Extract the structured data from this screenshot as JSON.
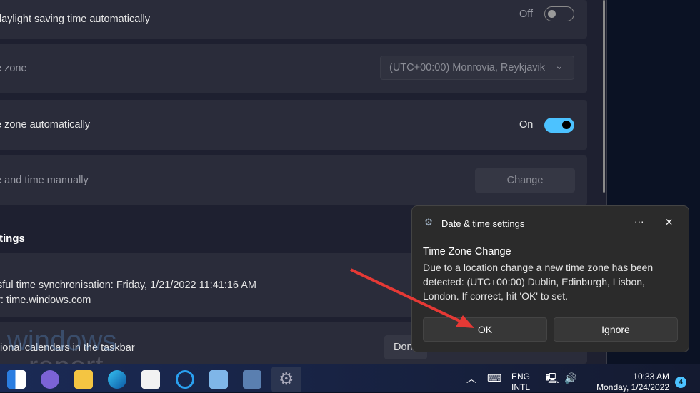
{
  "settings": {
    "dst_label": "daylight saving time automatically",
    "dst_state": "Off",
    "tz_label": "e zone",
    "tz_value": "(UTC+00:00) Monrovia, Reykjavik",
    "tz_auto_label": "e zone automatically",
    "tz_auto_state": "On",
    "manual_label": "e and time manually",
    "change_label": "Change",
    "section_title": "ttings",
    "sync_line1": "sful time synchronisation: Friday, 1/21/2022 11:41:16 AM",
    "sync_line2": "r: time.windows.com",
    "calendars_label": "tional calendars in the taskbar",
    "calendars_value": "Don"
  },
  "popup": {
    "app": "Date & time settings",
    "more": "···",
    "close": "✕",
    "title": "Time Zone Change",
    "body": "Due to a location change a new time zone has been detected: (UTC+00:00) Dublin, Edinburgh, Lisbon, London. If correct, hit 'OK' to set.",
    "ok": "OK",
    "ignore": "Ignore"
  },
  "watermark": {
    "line1": "windows",
    "line2": "report"
  },
  "taskbar": {
    "lang1": "ENG",
    "lang2": "INTL",
    "time": "10:33 AM",
    "date": "Monday, 1/24/2022",
    "badge": "4",
    "chevron": "︿"
  },
  "colors": {
    "accent": "#4cc2ff",
    "arrow": "#e53935"
  }
}
